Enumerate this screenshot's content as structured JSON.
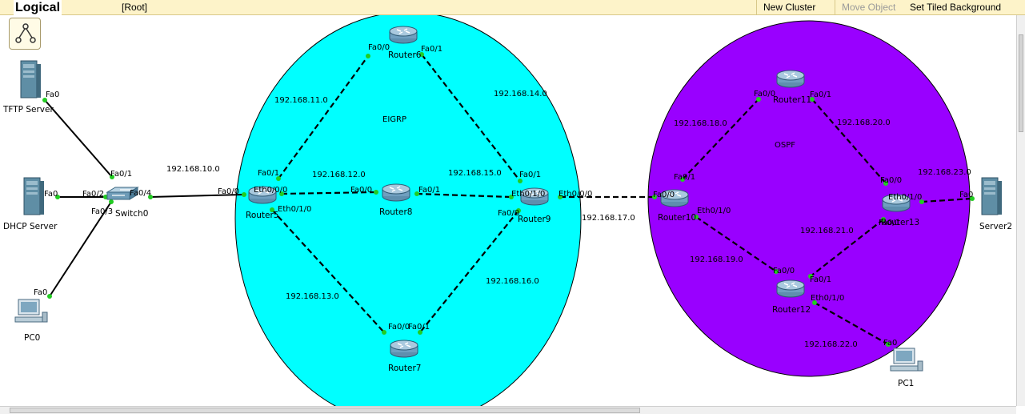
{
  "toolbar": {
    "title": "Logical",
    "breadcrumb": "[Root]",
    "new_cluster": "New Cluster",
    "move_object": "Move Object",
    "set_tiled_background": "Set Tiled Background"
  },
  "colors": {
    "eigrp_area": "#00ffff",
    "ospf_area": "#9900ff",
    "link": "#000000",
    "port_up": "#22cc22"
  },
  "areas": {
    "eigrp": "EIGRP",
    "ospf": "OSPF"
  },
  "devices": {
    "tftp_server": "TFTP Server",
    "dhcp_server": "DHCP Server",
    "pc0": "PC0",
    "switch0": "Switch0",
    "router5": "Router5",
    "router6": "Router6",
    "router7": "Router7",
    "router8": "Router8",
    "router9": "Router9",
    "router10": "Router10",
    "router11": "Router11",
    "router12": "Router12",
    "router13": "Router13",
    "server2": "Server2",
    "pc1": "PC1"
  },
  "networks": {
    "n10": "192.168.10.0",
    "n11": "192.168.11.0",
    "n12": "192.168.12.0",
    "n13": "192.168.13.0",
    "n14": "192.168.14.0",
    "n15": "192.168.15.0",
    "n16": "192.168.16.0",
    "n17": "192.168.17.0",
    "n18": "192.168.18.0",
    "n19": "192.168.19.0",
    "n20": "192.168.20.0",
    "n21": "192.168.21.0",
    "n22": "192.168.22.0",
    "n23": "192.168.23.0"
  },
  "ports": {
    "tftp_fa0": "Fa0",
    "dhcp_fa0": "Fa0",
    "pc0_fa0": "Fa0",
    "sw_fa01": "Fa0/1",
    "sw_fa02": "Fa0/2",
    "sw_fa03": "Fa0/3",
    "sw_fa04": "Fa0/4",
    "r5_fa00": "Fa0/0",
    "r5_fa01": "Fa0/1",
    "r5_eth000": "Eth0/0/0",
    "r5_eth010": "Eth0/1/0",
    "r6_fa00": "Fa0/0",
    "r6_fa01": "Fa0/1",
    "r8_fa00": "Fa0/0",
    "r8_fa01": "Fa0/1",
    "r9_fa01": "Fa0/1",
    "r9_eth010": "Eth0/1/0",
    "r9_eth000": "Eth0/0/0",
    "r9_fa00": "Fa0/0",
    "r7_fa00": "Fa0/0",
    "r7_fa01": "Fa0/1",
    "r10_fa01": "Fa0/1",
    "r10_fa00": "Fa0/0",
    "r10_eth010": "Eth0/1/0",
    "r11_fa00": "Fa0/0",
    "r11_fa01": "Fa0/1",
    "r13_fa00": "Fa0/0",
    "r13_eth010": "Eth0/1/0",
    "r13_fa01": "Fa0/1",
    "r12_fa00": "Fa0/0",
    "r12_fa01": "Fa0/1",
    "r12_eth010": "Eth0/1/0",
    "server2_fa0": "Fa0",
    "pc1_fa0": "Fa0"
  }
}
